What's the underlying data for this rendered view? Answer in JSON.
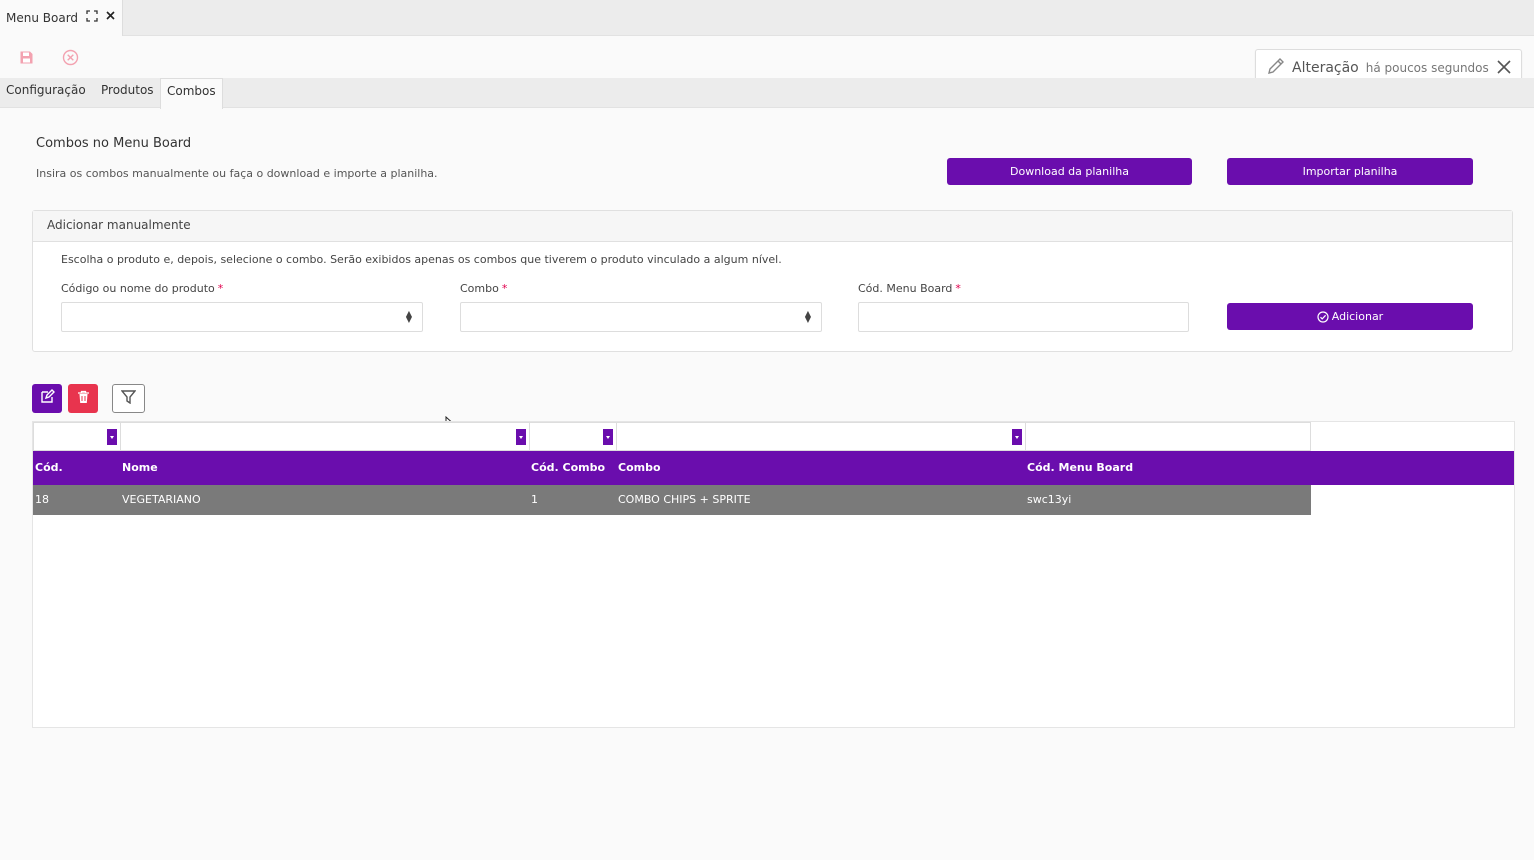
{
  "window": {
    "tab_title": "Menu Board",
    "expand_icon": "expand-icon",
    "close_icon": "close-icon"
  },
  "toolbar": {
    "save_icon": "save-icon",
    "cancel_icon": "cancel-circle-icon"
  },
  "notice": {
    "icon": "pencil-icon",
    "strong_text": "Alteração",
    "light_text": "há poucos segundos",
    "close_icon": "close-icon"
  },
  "tabs": [
    {
      "label": "Configuração"
    },
    {
      "label": "Produtos"
    },
    {
      "label": "Combos"
    }
  ],
  "section": {
    "title": "Combos no Menu Board",
    "subtitle": "Insira os combos manualmente ou faça o download e importe a planilha.",
    "download_label": "Download da planilha",
    "import_label": "Importar planilha"
  },
  "manual": {
    "header": "Adicionar manualmente",
    "description": "Escolha o produto e, depois, selecione o combo. Serão exibidos apenas os combos que tiverem o produto vinculado a algum nível.",
    "product_label": "Código ou nome do produto",
    "combo_label": "Combo",
    "code_label": "Cód. Menu Board",
    "required_mark": "*",
    "product_value": "",
    "combo_value": "",
    "code_value": "",
    "add_label": "Adicionar"
  },
  "grid_actions": {
    "edit_icon": "edit-icon",
    "delete_icon": "trash-icon",
    "filter_icon": "filter-icon"
  },
  "grid": {
    "columns": [
      "Cód.",
      "Nome",
      "Cód. Combo",
      "Combo",
      "Cód. Menu Board"
    ],
    "rows": [
      [
        "18",
        "VEGETARIANO",
        "1",
        "COMBO CHIPS + SPRITE",
        "swc13yi"
      ]
    ]
  },
  "colors": {
    "accent": "#6a0dad",
    "danger": "#e8344e",
    "row_selected": "#7a7a7a"
  }
}
